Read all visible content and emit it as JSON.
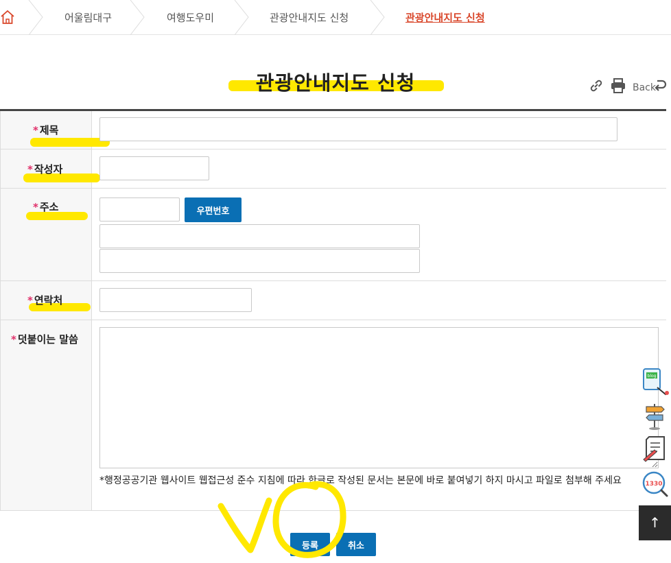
{
  "breadcrumb": {
    "home_icon": "home-icon",
    "items": [
      "어울림대구",
      "여행도우미",
      "관광안내지도 신청",
      "관광안내지도 신청"
    ]
  },
  "page": {
    "title": "관광안내지도 신청",
    "tools": {
      "link_icon": "link-icon",
      "print_icon": "printer-icon",
      "back_label": "Back",
      "back_icon": "back-arrow-icon"
    }
  },
  "form": {
    "required_mark": "*",
    "fields": {
      "subject": {
        "label": "제목",
        "value": ""
      },
      "author": {
        "label": "작성자",
        "value": ""
      },
      "address": {
        "label": "주소",
        "zip_value": "",
        "zip_button": "우편번호",
        "line1_value": "",
        "line2_value": ""
      },
      "contact": {
        "label": "연락처",
        "value": ""
      },
      "message": {
        "label": "덧붙이는 말씀",
        "value": "",
        "notice": "*행정공공기관 웹사이트 웹접근성 준수 지침에 따라 한글로 작성된 문서는 본문에 바로 붙여넣기 하지 마시고 파일로 첨부해 주세요"
      }
    },
    "submit_label": "등록",
    "cancel_label": "취소"
  },
  "quick_menu": {
    "items": [
      "blog-icon",
      "signpost-icon",
      "document-pen-icon",
      "1330-call-icon"
    ],
    "call_number": "1330",
    "top_arrow": "↑"
  },
  "colors": {
    "accent": "#d9472b",
    "button": "#0a6fb4",
    "highlight": "#ffe800",
    "required": "#e0306a"
  }
}
